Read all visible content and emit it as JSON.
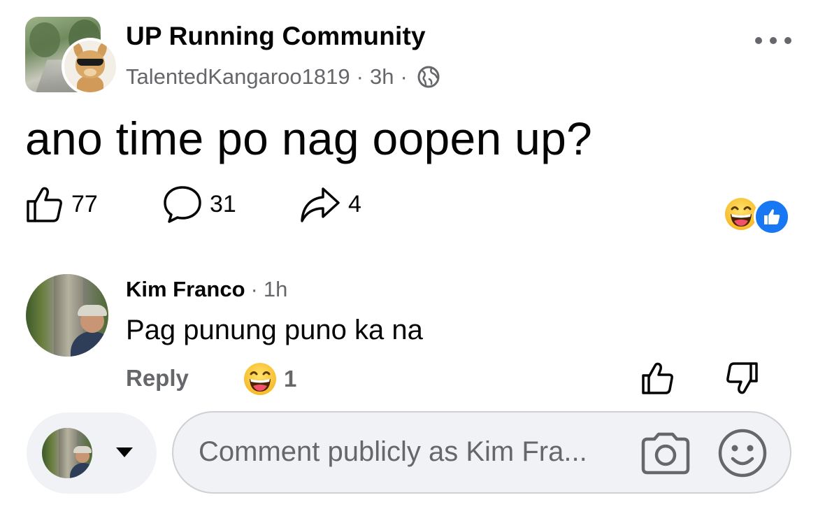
{
  "post": {
    "group_name": "UP Running Community",
    "author": "TalentedKangaroo1819",
    "separator": "·",
    "time": "3h",
    "text": "ano time po nag oopen up?"
  },
  "actions": {
    "likes": "77",
    "comments": "31",
    "shares": "4"
  },
  "reactions_summary": [
    "laughing-emoji",
    "like-icon"
  ],
  "comment": {
    "author": "Kim Franco",
    "separator": "·",
    "time": "1h",
    "text": "Pag punung puno ka na",
    "reply_label": "Reply",
    "reaction_count": "1"
  },
  "composer": {
    "placeholder": "Comment publicly as Kim Fra..."
  },
  "colors": {
    "text": "#050505",
    "secondary": "#65676b",
    "accent": "#1877f2",
    "input_bg": "#f0f2f5",
    "border": "#ced0d4"
  }
}
